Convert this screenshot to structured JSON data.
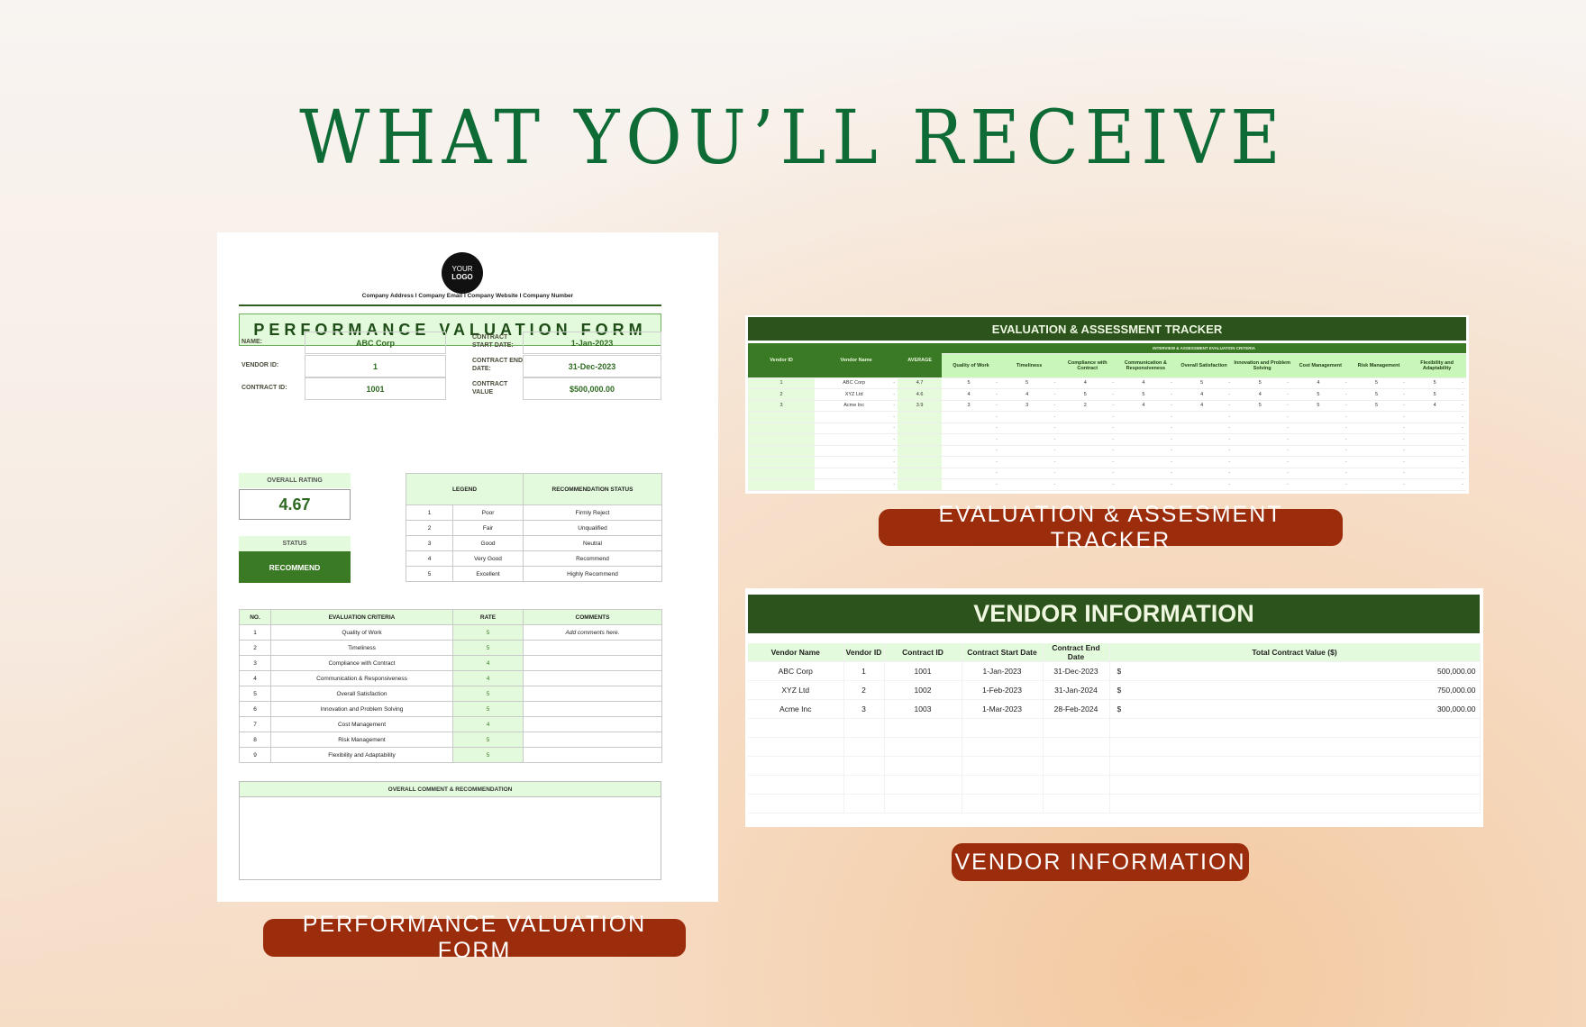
{
  "headline": "WHAT YOU’LL RECEIVE",
  "labels": {
    "form": "PERFORMANCE VALUATION FORM",
    "tracker": "EVALUATION & ASSESMENT TRACKER",
    "vendor": "VENDOR INFORMATION"
  },
  "colors": {
    "headline": "#0f6b35",
    "pill": "#9c2d0c",
    "dark_green": "#2b531b",
    "light_green": "#e3fbdc"
  },
  "form": {
    "logo": {
      "line1": "YOUR",
      "line2": "LOGO"
    },
    "company_line": "Company Address  I  Company Email  I  Company Website  I  Company Number",
    "title": "PERFORMANCE VALUATION FORM",
    "fields": {
      "name_label": "NAME:",
      "name": "ABC Corp",
      "vendor_id_label": "VENDOR ID:",
      "vendor_id": "1",
      "contract_id_label": "CONTRACT ID:",
      "contract_id": "1001",
      "start_label": "CONTRACT START DATE:",
      "start": "1-Jan-2023",
      "end_label": "CONTRACT END DATE:",
      "end": "31-Dec-2023",
      "value_label": "CONTRACT VALUE",
      "value": "$500,000.00"
    },
    "overall_rating_label": "OVERALL RATING",
    "overall_rating": "4.67",
    "status_label": "STATUS",
    "status": "RECOMMEND",
    "legend": {
      "headers": [
        "LEGEND",
        "RECOMMENDATION STATUS"
      ],
      "rows": [
        [
          "1",
          "Poor",
          "Firmly Reject"
        ],
        [
          "2",
          "Fair",
          "Unqualified"
        ],
        [
          "3",
          "Good",
          "Neutral"
        ],
        [
          "4",
          "Very Good",
          "Recommend"
        ],
        [
          "5",
          "Excellent",
          "Highly Recommend"
        ]
      ]
    },
    "criteria": {
      "headers": [
        "NO.",
        "EVALUATION CRITERIA",
        "RATE",
        "COMMENTS"
      ],
      "rows": [
        [
          "1",
          "Quality of Work",
          "5",
          "Add comments here."
        ],
        [
          "2",
          "Timeliness",
          "5",
          ""
        ],
        [
          "3",
          "Compliance with Contract",
          "4",
          ""
        ],
        [
          "4",
          "Communication & Responsiveness",
          "4",
          ""
        ],
        [
          "5",
          "Overall Satisfaction",
          "5",
          ""
        ],
        [
          "6",
          "Innovation and Problem Solving",
          "5",
          ""
        ],
        [
          "7",
          "Cost Management",
          "4",
          ""
        ],
        [
          "8",
          "Risk Management",
          "5",
          ""
        ],
        [
          "9",
          "Flexibility and Adaptability",
          "5",
          ""
        ]
      ]
    },
    "overall_comment_label": "OVERALL COMMENT & RECOMMENDATION"
  },
  "tracker": {
    "title": "EVALUATION & ASSESSMENT TRACKER",
    "headers": {
      "vendor_id": "Vendor ID",
      "vendor_name": "Vendor Name",
      "average": "AVERAGE",
      "group": "INTERVIEW & ASSESSMENT EVALUATION CRITERIA"
    },
    "criteria": [
      "Quality of Work",
      "Timeliness",
      "Compliance with Contract",
      "Communication & Responsiveness",
      "Overall Satisfaction",
      "Innovation and Problem Solving",
      "Cost Management",
      "Risk Management",
      "Flexibility and Adaptability"
    ],
    "dropdown_marker": "-",
    "rows": [
      {
        "id": "1",
        "name": "ABC Corp",
        "avg": "4.7",
        "scores": [
          "5",
          "5",
          "4",
          "4",
          "5",
          "5",
          "4",
          "5",
          "5"
        ]
      },
      {
        "id": "2",
        "name": "XYZ Ltd",
        "avg": "4.6",
        "scores": [
          "4",
          "4",
          "5",
          "5",
          "4",
          "4",
          "5",
          "5",
          "5"
        ]
      },
      {
        "id": "3",
        "name": "Acme Inc",
        "avg": "3.9",
        "scores": [
          "3",
          "3",
          "2",
          "4",
          "4",
          "5",
          "5",
          "5",
          "4"
        ]
      }
    ]
  },
  "vendor": {
    "title": "VENDOR INFORMATION",
    "headers": [
      "Vendor Name",
      "Vendor ID",
      "Contract ID",
      "Contract Start Date",
      "Contract End Date",
      "Total Contract Value ($)"
    ],
    "currency": "$",
    "rows": [
      [
        "ABC Corp",
        "1",
        "1001",
        "1-Jan-2023",
        "31-Dec-2023",
        "500,000.00"
      ],
      [
        "XYZ Ltd",
        "2",
        "1002",
        "1-Feb-2023",
        "31-Jan-2024",
        "750,000.00"
      ],
      [
        "Acme Inc",
        "3",
        "1003",
        "1-Mar-2023",
        "28-Feb-2024",
        "300,000.00"
      ]
    ]
  }
}
